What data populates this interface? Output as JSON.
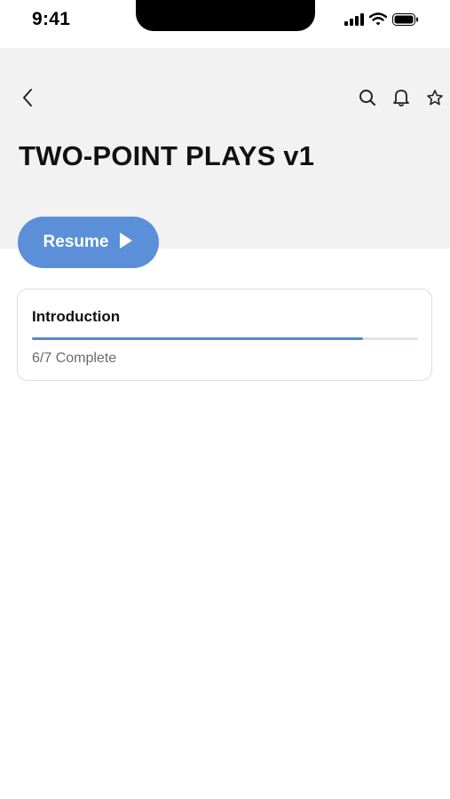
{
  "status_bar": {
    "time": "9:41",
    "icons": [
      "signal-icon",
      "wifi-icon",
      "battery-icon"
    ]
  },
  "nav": {
    "back_icon": "chevron-left-icon",
    "actions": [
      "search-icon",
      "bell-icon",
      "star-icon"
    ]
  },
  "page": {
    "title": "TWO-POINT PLAYS v1"
  },
  "resume_button": {
    "label": "Resume",
    "icon": "play-icon"
  },
  "sections": [
    {
      "title": "Introduction",
      "progress": 0.857,
      "status": "6/7 Complete"
    }
  ],
  "colors": {
    "accent": "#5b8fd8",
    "header_bg": "#f2f2f2",
    "progress": "#5b86d0"
  }
}
